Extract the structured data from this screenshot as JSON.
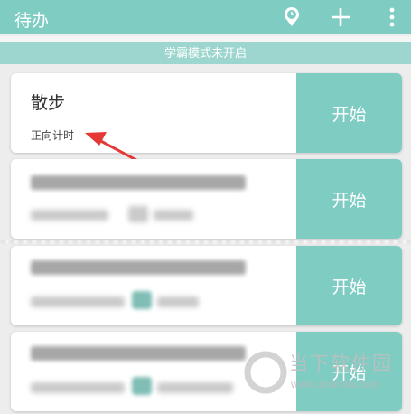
{
  "appbar": {
    "title": "待办",
    "icons": [
      "clock-icon",
      "plus-icon",
      "more-vert-icon"
    ]
  },
  "banner": {
    "text": "学霸模式未开启"
  },
  "tasks": [
    {
      "name": "散步",
      "mode": "正向计时",
      "start_label": "开始"
    },
    {
      "start_label": "开始"
    },
    {
      "start_label": "开始"
    },
    {
      "start_label": "开始"
    }
  ],
  "watermark": {
    "text": "当下软件园",
    "url": "www.downxia.com"
  },
  "colors": {
    "accent": "#7fccc3",
    "banner": "#9dd6cf",
    "arrow": "#e53935"
  }
}
